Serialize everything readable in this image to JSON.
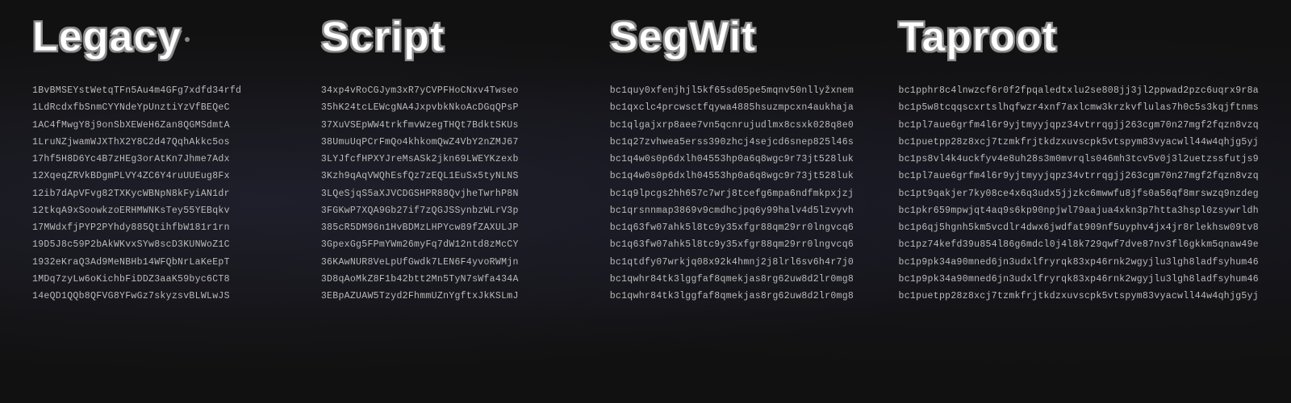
{
  "columns": [
    {
      "title": "Legacy",
      "addresses": [
        "1BvBMSEYstWetqTFn5Au4m4GFg7xdfd34rfd",
        "1LdRcdxfbSnmCYYNdeYpUnztiYzVfBEQeC",
        "1AC4fMwgY8j9onSbXEWeH6Zan8QGMSdmtA",
        "1LruNZjwamWJXThX2Y8C2d47QqhAkkc5os",
        "17hf5H8D6Yc4B7zHEg3orAtKn7Jhme7Adx",
        "12XqeqZRVkBDgmPLVY4ZC6Y4ruUUEug8Fx",
        "12ib7dApVFvg82TXKycWBNpN8kFyiAN1dr",
        "12tkqA9xSoowkzoERHMWNKsTey55YEBqkv",
        "17MWdxfjPYP2PYhdy885QtihfbW181r1rn",
        "19D5J8c59P2bAkWKvxSYw8scD3KUNWoZ1C",
        "1932eKraQ3Ad9MeNBHb14WFQbNrLaKeEpT",
        "1MDq7zyLw6oKichbFiDDZ3aaK59byc6CT8",
        "14eQD1QQb8QFVG8YFwGz7skyzsvBLWLwJS"
      ]
    },
    {
      "title": "Script",
      "addresses": [
        "34xp4vRoCGJym3xR7yCVPFHoCNxv4Twseo",
        "35hK24tcLEWcgNA4JxpvbkNkoAcDGqQPsP",
        "37XuVSEpWW4trkfmvWzegTHQt7BdktSKUs",
        "38UmuUqPCrFmQo4khkomQwZ4VbY2nZMJ67",
        "3LYJfcfHPXYJreMsASk2jkn69LWEYKzexb",
        "3Kzh9qAqVWQhEsfQz7zEQL1EuSx5tyNLNS",
        "3LQeSjqS5aXJVCDGSHPR88QvjheTwrhP8N",
        "3FGKwP7XQA9Gb27if7zQGJSSynbzWLrV3p",
        "385cR5DM96n1HvBDMzLHPYcw89fZAXULJP",
        "3GpexGg5FPmYWm26myFq7dW12ntd8zMcCY",
        "36KAwNUR8VeLpUfGwdk7LEN6F4yvoRWMjn",
        "3D8qAoMkZ8F1b42btt2Mn5TyN7sWfa434A",
        "3EBpAZUAW5Tzyd2FhmmUZnYgftxJkKSLmJ"
      ]
    },
    {
      "title": "SegWit",
      "addresses": [
        "bc1quy0xfenjhjl5kf65sd05pe5mqnv50nllyžxnem",
        "bc1qxclc4prcwsctfqywa4885hsuzmpcxn4aukhaja",
        "bc1qlgajxrp8aee7vn5qcnrujudlmx8csxk028q8e0",
        "bc1q27zvhwea5erss390zhcj4sejcd6snep825l46s",
        "bc1q4w0s0p6dxlh04553hp0a6q8wgc9r73jt528luk",
        "bc1q4w0s0p6dxlh04553hp0a6q8wgc9r73jt528luk",
        "bc1q9lpcgs2hh657c7wrj8tcefg6mpa6ndfmkpxjzj",
        "bc1qrsnnmap3869v9cmdhcjpq6y99halv4d5lzvyvh",
        "bc1q63fw07ahk5l8tc9y35xfgr88qm29rr0lngvcq6",
        "bc1q63fw07ahk5l8tc9y35xfgr88qm29rr0lngvcq6",
        "bc1qtdfy07wrkjq08x92k4hmnj2j8lrl6sv6h4r7j0",
        "bc1qwhr84tk3lggfaf8qmekjas8rg62uw8d2lr0mg8",
        "bc1qwhr84tk3lggfaf8qmekjas8rg62uw8d2lr0mg8"
      ]
    },
    {
      "title": "Taproot",
      "addresses": [
        "bc1pphr8c4lnwzcf6r0f2fpqaledtxlu2se808jj3jl2ppwad2pzc6uqrx9r8a",
        "bc1p5w8tcqqscxrtslhqfwzr4xnf7axlcmw3krzkvflulas7h0c5s3kqjftnms",
        "bc1pl7aue6grfm4l6r9yjtmyyjqpz34vtrrqgjj263cgm70n27mgf2fqzn8vzq",
        "bc1puetpp28z8xcj7tzmkfrjtkdzxuvscpk5vtspym83vyacwll44w4qhjg5yj",
        "bc1ps8vl4k4uckfyv4e8uh28s3m0mvrqls046mh3tcv5v0j3l2uetzssfutjs9",
        "bc1pl7aue6grfm4l6r9yjtmyyjqpz34vtrrqgjj263cgm70n27mgf2fqzn8vzq",
        "bc1pt9qakjer7ky08ce4x6q3udx5jjzkc6mwwfu8jfs0a56qf8mrswzq9nzdeg",
        "bc1pkr659mpwjqt4aq9s6kp90npjwl79aajua4xkn3p7htta3hspl0zsywrldh",
        "bc1p6qj5hgnh5km5vcdlr4dwx6jwdfat909nf5uyphv4jx4jr8rlekhsw09tv8",
        "bc1pz74kefd39u854l86g6mdcl0j4l8k729qwf7dve87nv3fl6gkkm5qnaw49e",
        "bc1p9pk34a90mned6jn3udxlfryrqk83xp46rnk2wgyjlu3lgh8ladfsyhum46",
        "bc1p9pk34a90mned6jn3udxlfryrqk83xp46rnk2wgyjlu3lgh8ladfsyhum46",
        "bc1puetpp28z8xcj7tzmkfrjtkdzxuvscpk5vtspym83vyacwll44w4qhjg5yj"
      ]
    }
  ]
}
